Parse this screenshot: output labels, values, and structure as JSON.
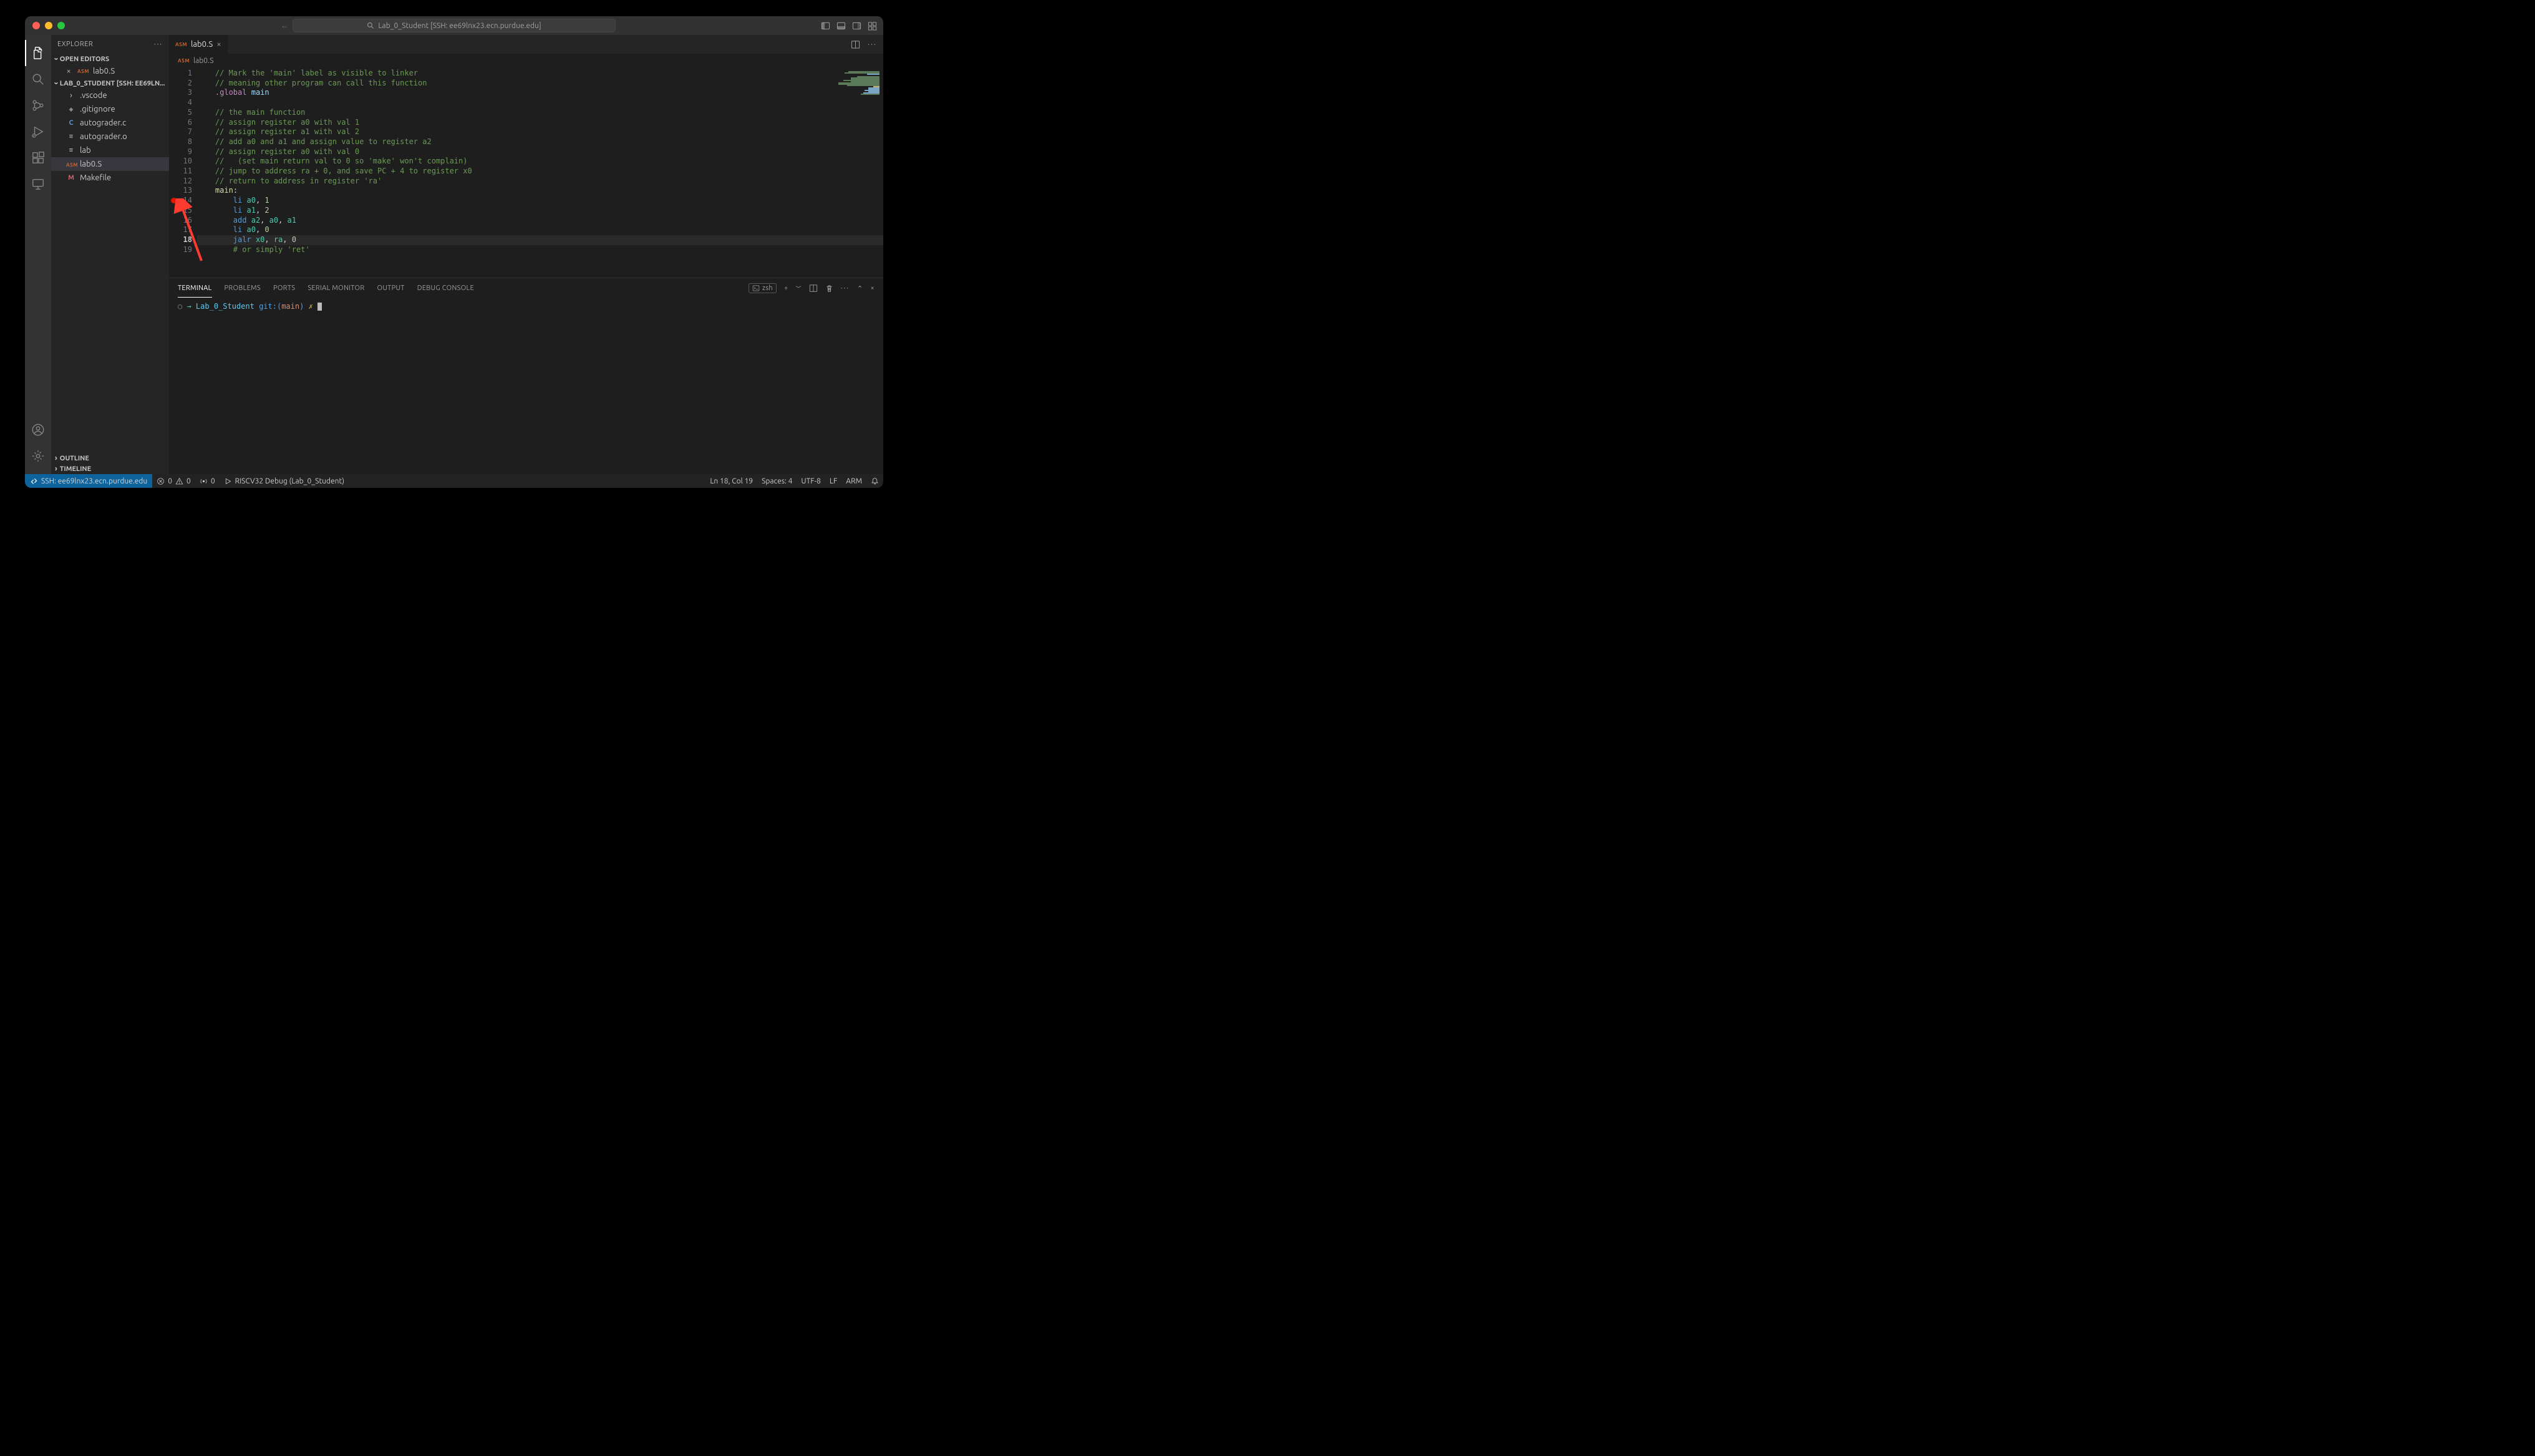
{
  "titlebar": {
    "search_label": "Lab_0_Student [SSH: ee69lnx23.ecn.purdue.edu]"
  },
  "sidebar": {
    "title": "EXPLORER",
    "open_editors_label": "OPEN EDITORS",
    "open_editor_item": "lab0.S",
    "folder_label": "LAB_0_STUDENT [SSH: EE69LN...",
    "files": [
      {
        "name": ".vscode",
        "icon": "chev-right",
        "type": "folder"
      },
      {
        "name": ".gitignore",
        "icon": "dot",
        "type": "file"
      },
      {
        "name": "autograder.c",
        "icon": "C",
        "type": "file",
        "iconColor": "#6196cc"
      },
      {
        "name": "autograder.o",
        "icon": "≡",
        "type": "file"
      },
      {
        "name": "lab",
        "icon": "≡",
        "type": "file"
      },
      {
        "name": "lab0.S",
        "icon": "ASM",
        "type": "file",
        "selected": true
      },
      {
        "name": "Makefile",
        "icon": "M",
        "type": "file",
        "iconColor": "#d16969"
      }
    ],
    "outline_label": "OUTLINE",
    "timeline_label": "TIMELINE"
  },
  "tab": {
    "filename": "lab0.S"
  },
  "breadcrumb": {
    "filename": "lab0.S"
  },
  "editor": {
    "breakpoint_line": 14,
    "current_line": 18,
    "lines": [
      {
        "n": 1,
        "t": "comment",
        "text": "// Mark the 'main' label as visible to linker"
      },
      {
        "n": 2,
        "t": "comment",
        "text": "// meaning other program can call this function"
      },
      {
        "n": 3,
        "t": "directive",
        "dir": ".global",
        "ident": "main"
      },
      {
        "n": 4,
        "t": "blank"
      },
      {
        "n": 5,
        "t": "comment",
        "text": "// the main function"
      },
      {
        "n": 6,
        "t": "comment",
        "text": "// assign register a0 with val 1"
      },
      {
        "n": 7,
        "t": "comment",
        "text": "// assign register a1 with val 2"
      },
      {
        "n": 8,
        "t": "comment",
        "text": "// add a0 and a1 and assign value to register a2"
      },
      {
        "n": 9,
        "t": "comment",
        "text": "// assign register a0 with val 0"
      },
      {
        "n": 10,
        "t": "comment",
        "text": "//   (set main return val to 0 so 'make' won't complain)"
      },
      {
        "n": 11,
        "t": "comment",
        "text": "// jump to address ra + 0, and save PC + 4 to register x0"
      },
      {
        "n": 12,
        "t": "comment",
        "text": "// return to address in register 'ra'"
      },
      {
        "n": 13,
        "t": "label",
        "label": "main"
      },
      {
        "n": 14,
        "t": "instr",
        "op": "li",
        "args": [
          "a0",
          "1"
        ]
      },
      {
        "n": 15,
        "t": "instr",
        "op": "li",
        "args": [
          "a1",
          "2"
        ]
      },
      {
        "n": 16,
        "t": "instr",
        "op": "add",
        "args": [
          "a2",
          "a0",
          "a1"
        ]
      },
      {
        "n": 17,
        "t": "instr",
        "op": "li",
        "args": [
          "a0",
          "0"
        ]
      },
      {
        "n": 18,
        "t": "instr",
        "op": "jalr",
        "args": [
          "x0",
          "ra",
          "0"
        ]
      },
      {
        "n": 19,
        "t": "hashcomment",
        "text": "# or simply 'ret'"
      }
    ]
  },
  "panel": {
    "tabs": [
      "TERMINAL",
      "PROBLEMS",
      "PORTS",
      "SERIAL MONITOR",
      "OUTPUT",
      "DEBUG CONSOLE"
    ],
    "active_tab": "TERMINAL",
    "shell_name": "zsh",
    "terminal": {
      "path": "Lab_0_Student",
      "git_label": "git:(",
      "branch": "main",
      "git_close": ")",
      "marker": "✗"
    }
  },
  "statusbar": {
    "remote": "SSH: ee69lnx23.ecn.purdue.edu",
    "errors": "0",
    "warnings": "0",
    "ports": "0",
    "run_config": "RISCV32 Debug (Lab_0_Student)",
    "ln_col": "Ln 18, Col 19",
    "spaces": "Spaces: 4",
    "encoding": "UTF-8",
    "eol": "LF",
    "lang": "ARM"
  }
}
